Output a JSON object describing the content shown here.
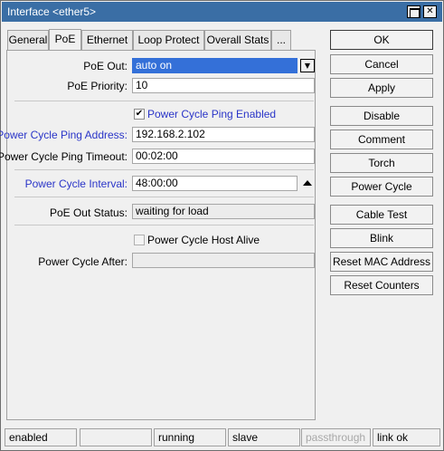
{
  "window": {
    "title": "Interface <ether5>"
  },
  "tabs": [
    "General",
    "PoE",
    "Ethernet",
    "Loop Protect",
    "Overall Stats",
    "..."
  ],
  "active_tab": "PoE",
  "form": {
    "poe_out": {
      "label": "PoE Out:",
      "value": "auto on"
    },
    "poe_priority": {
      "label": "PoE Priority:",
      "value": "10"
    },
    "power_cycle_ping_enabled": {
      "label": "Power Cycle Ping Enabled",
      "checked": true,
      "check_glyph": "✔"
    },
    "power_cycle_ping_address": {
      "label": "Power Cycle Ping Address:",
      "value": "192.168.2.102"
    },
    "power_cycle_ping_timeout": {
      "label": "Power Cycle Ping Timeout:",
      "value": "00:02:00"
    },
    "power_cycle_interval": {
      "label": "Power Cycle Interval:",
      "value": "48:00:00"
    },
    "poe_out_status": {
      "label": "PoE Out Status:",
      "value": "waiting for load"
    },
    "power_cycle_host_alive": {
      "label": "Power Cycle Host Alive",
      "checked": false
    },
    "power_cycle_after": {
      "label": "Power Cycle After:",
      "value": ""
    }
  },
  "buttons": {
    "ok": "OK",
    "cancel": "Cancel",
    "apply": "Apply",
    "disable": "Disable",
    "comment": "Comment",
    "torch": "Torch",
    "power_cycle": "Power Cycle",
    "cable_test": "Cable Test",
    "blink": "Blink",
    "reset_mac": "Reset MAC Address",
    "reset_counters": "Reset Counters"
  },
  "status_bar": [
    "enabled",
    "",
    "running",
    "slave",
    "passthrough",
    "link ok"
  ],
  "icons": {
    "dropdown": "▼",
    "close": "✕",
    "collapse_arrow": "up-triangle-icon"
  },
  "colors": {
    "title_bar": "#3a6ea5",
    "highlight_label": "#2a35c8",
    "selection": "#3470d8"
  }
}
